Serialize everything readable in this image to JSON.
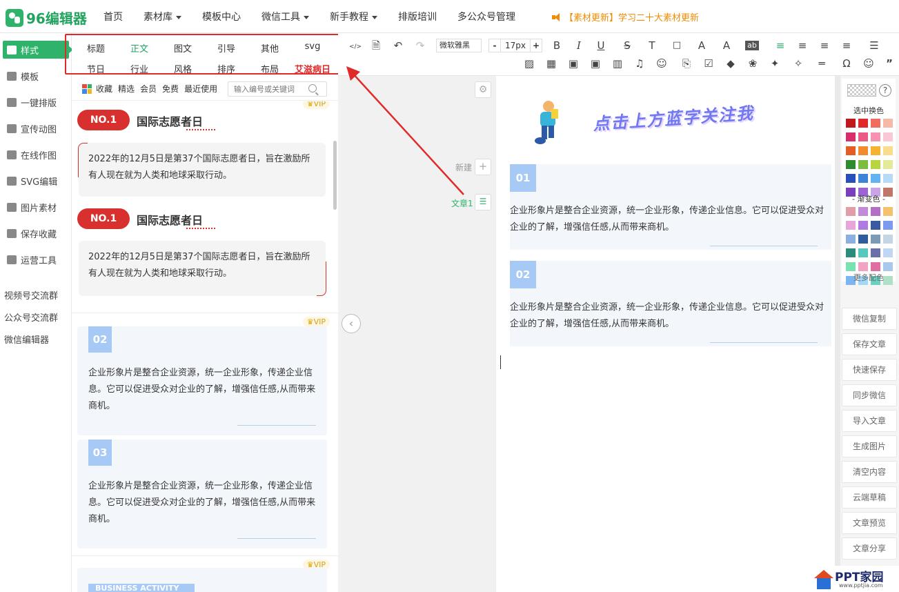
{
  "app": {
    "logo_text": "96编辑器",
    "brand_color": "#2fb36b"
  },
  "nav": {
    "items": [
      "首页",
      "素材库",
      "模板中心",
      "微信工具",
      "新手教程",
      "排版培训",
      "多公众号管理"
    ],
    "notice": "【素材更新】学习二十大素材更新"
  },
  "sidebar": {
    "items": [
      "样式",
      "模板",
      "一键排版",
      "宣传动图",
      "在线作图",
      "SVG编辑",
      "图片素材",
      "保存收藏",
      "运营工具"
    ],
    "links": [
      "视频号交流群",
      "公众号交流群",
      "微信编辑器"
    ]
  },
  "categories": {
    "row1": [
      "标题",
      "正文",
      "图文",
      "引导",
      "其他",
      "svg"
    ],
    "row2": [
      "节日",
      "行业",
      "风格",
      "排序",
      "布局",
      "艾滋病日"
    ],
    "active": "正文"
  },
  "filter": {
    "items": [
      "收藏",
      "精选",
      "会员",
      "免费",
      "最近使用"
    ],
    "search_placeholder": "输入编号或关键词"
  },
  "templates": {
    "vip_label": "VIP",
    "card1_badge": "NO.1",
    "card1_title": "国际志愿者日",
    "card1_text": "2022年的12月5日是第37个国际志愿者日，旨在激励所有人现在就为人类和地球采取行动。",
    "card2_badge": "NO.1",
    "card2_title": "国际志愿者日",
    "card2_text": "2022年的12月5日是第37个国际志愿者日，旨在激励所有人现在就为人类和地球采取行动。",
    "num1": "02",
    "num1_text": "企业形象片是整合企业资源，统一企业形象，传递企业信息。它可以促进受众对企业的了解，增强信任感,从而带来商机。",
    "num2": "03",
    "num2_text": "企业形象片是整合企业资源，统一企业形象，传递企业信息。它可以促进受众对企业的了解，增强信任感,从而带来商机。",
    "biz_label": "BUSINESS ACTIVITY"
  },
  "middle": {
    "new_label": "新建",
    "article_label": "文章1"
  },
  "toolbar": {
    "font_name": "微软雅黑",
    "font_size": "17px",
    "icons": [
      "html-icon",
      "doc-icon",
      "undo-icon",
      "redo-icon",
      "bold-icon",
      "italic-icon",
      "underline-icon",
      "strike-icon",
      "font-color-icon",
      "align-left-icon",
      "align-center-icon",
      "align-right-icon",
      "justify-icon",
      "table-icon",
      "image-icon",
      "music-icon",
      "omega-icon",
      "emoji-icon",
      "quote-icon"
    ]
  },
  "editor": {
    "banner_text": "点击上方蓝字关注我",
    "card1_num": "01",
    "card1_text": "企业形象片是整合企业资源，统一企业形象，传递企业信息。它可以促进受众对企业的了解，增强信任感,从而带来商机。",
    "card2_num": "02",
    "card2_text": "企业形象片是整合企业资源，统一企业形象，传递企业信息。它可以促进受众对企业的了解，增强信任感,从而带来商机。"
  },
  "palette": {
    "selected_label": "选中换色",
    "gradient_label": "- 渐变色 -",
    "more_label": "更多配色",
    "solid_colors": [
      "#c0181d",
      "#e0282a",
      "#ee6d5f",
      "#f6b9a8",
      "#d62f6c",
      "#ea5a85",
      "#f494b0",
      "#f8c9d4",
      "#e45d24",
      "#f28a2e",
      "#f6b233",
      "#f9dc8e",
      "#2e8b2f",
      "#7bbd3f",
      "#b7d441",
      "#e2ec98",
      "#2b4fb8",
      "#3d84d8",
      "#62b3f0",
      "#b7dbf6",
      "#7b3fbd",
      "#9b63d4",
      "#c9a5e6",
      "#c0776a"
    ],
    "gradient_colors": [
      "#e29ea8",
      "#c18bd9",
      "#b26fc4",
      "#f2c36c",
      "#e8a5d9",
      "#b07be0",
      "#3a5aa0",
      "#7c9bf0",
      "#8ab0e0",
      "#2f5c9a",
      "#7a9ab7",
      "#c4d5e6",
      "#2a8c7a",
      "#55c8c0",
      "#6a6fa8",
      "#c0d6f2",
      "#7ae2b0",
      "#f2a3c0",
      "#e06ea0",
      "#a8c8ec",
      "#7bb6f0",
      "#a0d8f8",
      "#6ad0c0",
      "#b0e0c8"
    ]
  },
  "right_buttons": [
    "微信复制",
    "保存文章",
    "快速保存",
    "同步微信",
    "导入文章",
    "生成图片",
    "清空内容",
    "云端草稿",
    "文章预览",
    "文章分享"
  ],
  "watermark": {
    "title": "PPT家园",
    "url": "www.pptjia.com"
  }
}
